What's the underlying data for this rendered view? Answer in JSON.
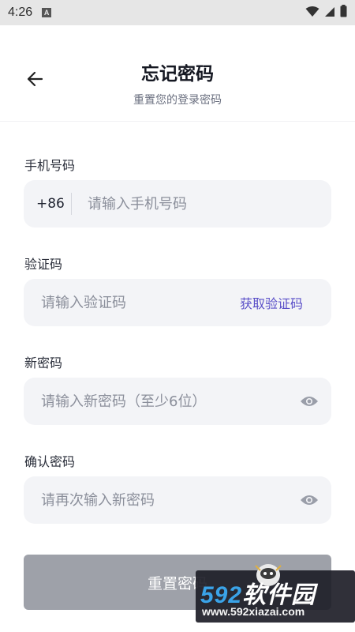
{
  "status_bar": {
    "time": "4:26",
    "notification_icon": "a-icon",
    "icons": [
      "wifi-icon",
      "signal-icon",
      "battery-icon"
    ]
  },
  "header": {
    "title": "忘记密码",
    "subtitle": "重置您的登录密码",
    "back_icon": "arrow-left-icon"
  },
  "form": {
    "phone": {
      "label": "手机号码",
      "prefix": "+86",
      "placeholder": "请输入手机号码",
      "value": ""
    },
    "code": {
      "label": "验证码",
      "placeholder": "请输入验证码",
      "value": "",
      "action_label": "获取验证码"
    },
    "new_password": {
      "label": "新密码",
      "placeholder": "请输入新密码（至少6位）",
      "value": "",
      "toggle_icon": "eye-icon"
    },
    "confirm_password": {
      "label": "确认密码",
      "placeholder": "请再次输入新密码",
      "value": "",
      "toggle_icon": "eye-icon"
    },
    "submit_label": "重置密码"
  },
  "watermark": {
    "brand_digits": "592",
    "brand_text": "软件园",
    "url": "www.592xiazai.com"
  },
  "colors": {
    "accent": "#5a4fc8",
    "field_bg": "#f3f4f7",
    "button_disabled": "#9ea1a9",
    "status_bar": "#e6e6e6"
  }
}
